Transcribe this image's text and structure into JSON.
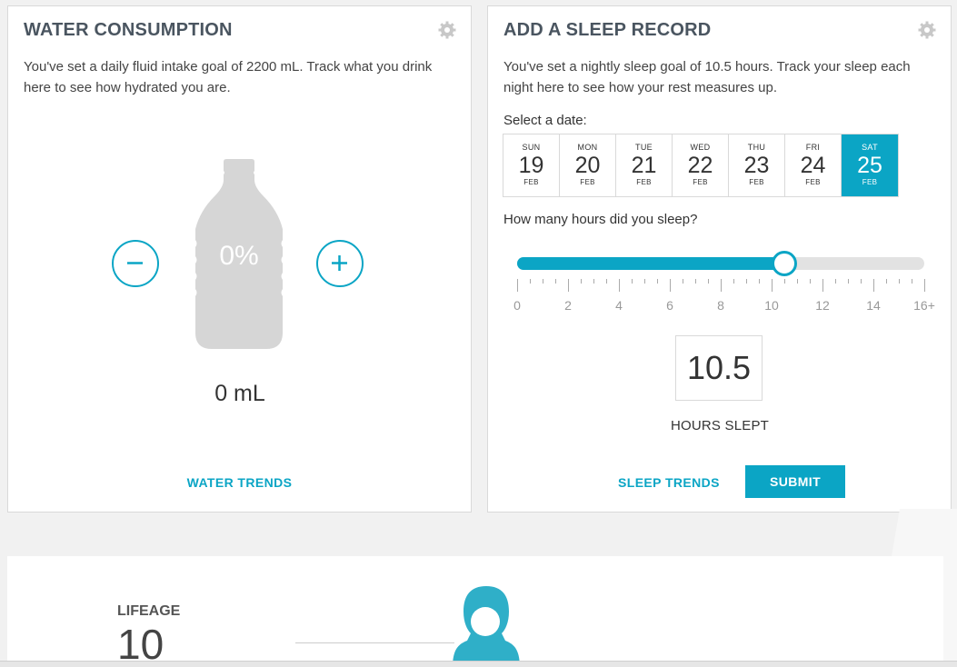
{
  "water": {
    "title": "WATER CONSUMPTION",
    "description": "You've set a daily fluid intake goal of 2200 mL. Track what you drink here to see how hydrated you are.",
    "percent_label": "0%",
    "percent": 0,
    "amount_label": "0 mL",
    "trends_label": "WATER TRENDS",
    "icons": {
      "settings": "gear-icon",
      "decrease": "minus-icon",
      "increase": "plus-icon",
      "bottle": "water-bottle-icon"
    }
  },
  "sleep": {
    "title": "ADD A SLEEP RECORD",
    "description": "You've set a nightly sleep goal of 10.5 hours. Track your sleep each night here to see how your rest measures up.",
    "date_label": "Select a date:",
    "dates": [
      {
        "dow": "SUN",
        "day": "19",
        "month": "FEB"
      },
      {
        "dow": "MON",
        "day": "20",
        "month": "FEB"
      },
      {
        "dow": "TUE",
        "day": "21",
        "month": "FEB"
      },
      {
        "dow": "WED",
        "day": "22",
        "month": "FEB"
      },
      {
        "dow": "THU",
        "day": "23",
        "month": "FEB"
      },
      {
        "dow": "FRI",
        "day": "24",
        "month": "FEB"
      },
      {
        "dow": "SAT",
        "day": "25",
        "month": "FEB"
      }
    ],
    "selected_index": 6,
    "hours_question": "How many hours did you sleep?",
    "slider": {
      "min": 0,
      "max": 16,
      "value": 10.5,
      "labels": [
        "0",
        "2",
        "4",
        "6",
        "8",
        "10",
        "12",
        "14",
        "16+"
      ]
    },
    "hours_value": "10.5",
    "hours_caption": "HOURS SLEPT",
    "trends_label": "SLEEP TRENDS",
    "submit_label": "SUBMIT"
  },
  "lifeage": {
    "label": "LIFEAGE",
    "value": "10"
  },
  "colors": {
    "accent": "#0ba5c5",
    "bottle": "#d6d6d6",
    "title": "#4a5560",
    "page_bg": "#f1f1f1"
  }
}
